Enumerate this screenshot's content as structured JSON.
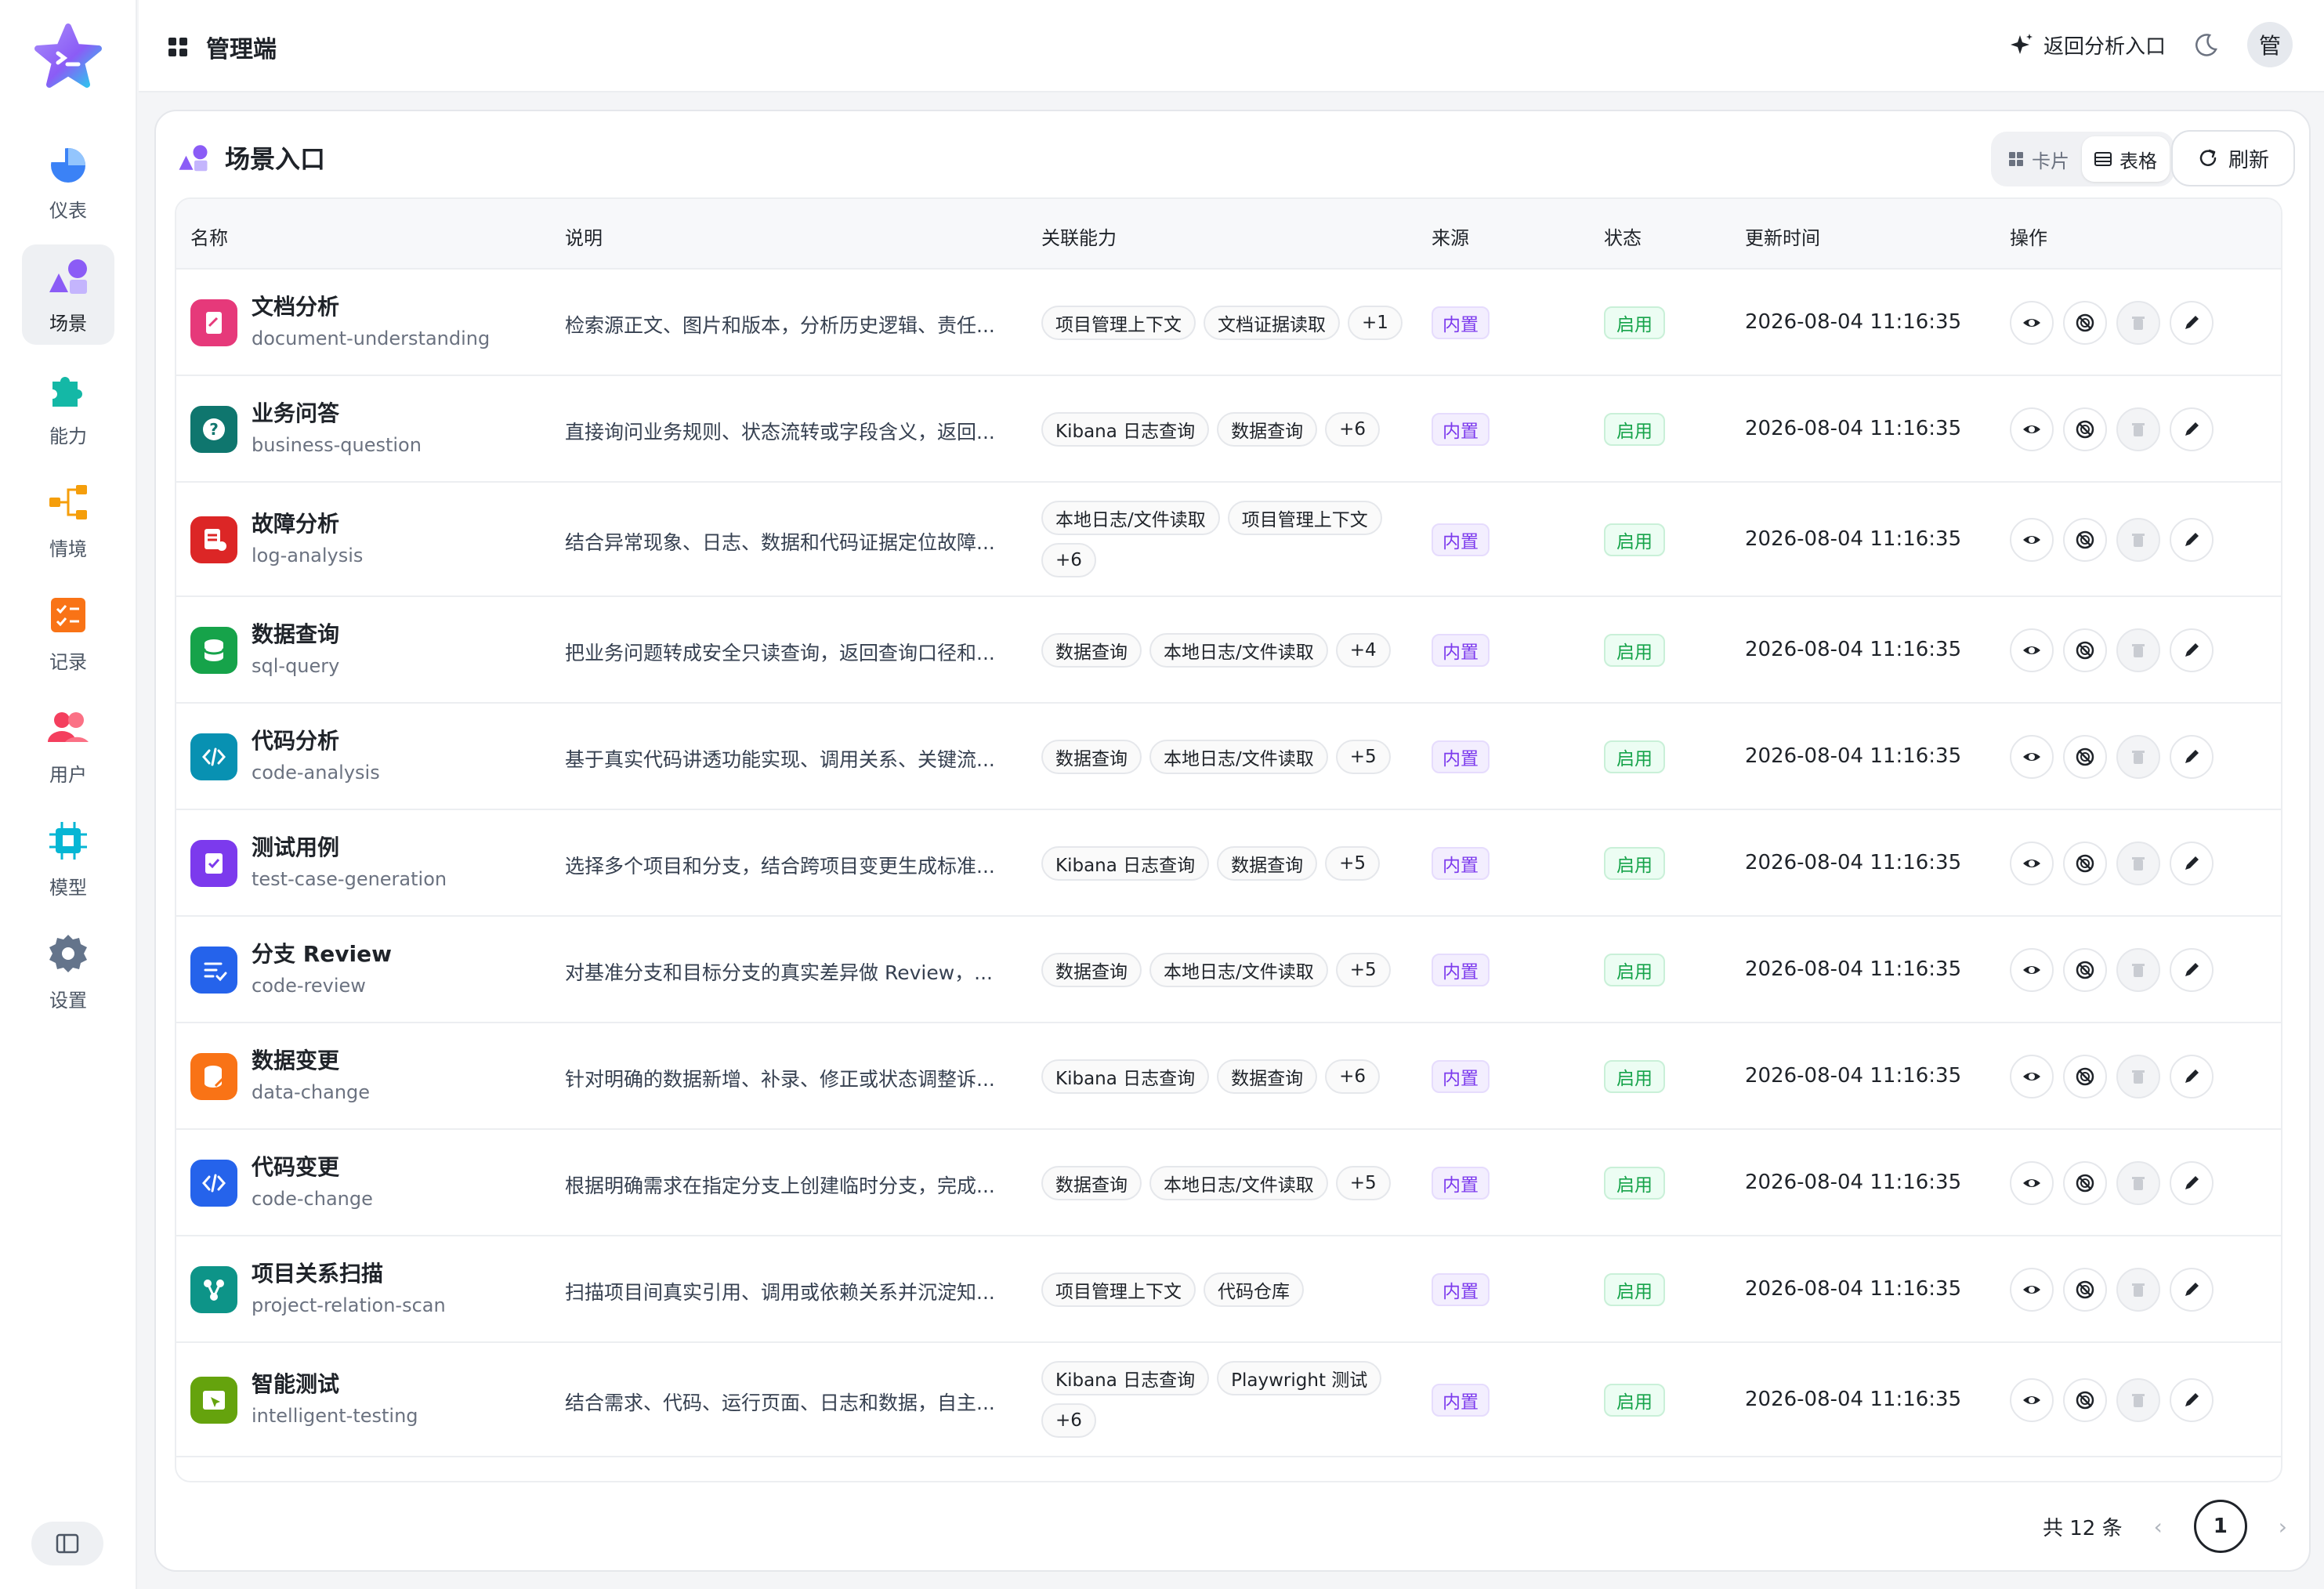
{
  "header": {
    "title": "管理端",
    "back_label": "返回分析入口",
    "avatar_text": "管"
  },
  "sidebar": {
    "items": [
      {
        "label": "仪表",
        "icon": "pie-chart-icon"
      },
      {
        "label": "场景",
        "icon": "shapes-icon"
      },
      {
        "label": "能力",
        "icon": "puzzle-icon"
      },
      {
        "label": "情境",
        "icon": "flow-icon"
      },
      {
        "label": "记录",
        "icon": "checklist-icon"
      },
      {
        "label": "用户",
        "icon": "users-icon"
      },
      {
        "label": "模型",
        "icon": "chip-icon"
      },
      {
        "label": "设置",
        "icon": "gear-icon"
      }
    ],
    "active": "场景"
  },
  "panel": {
    "title": "场景入口",
    "view_card": "卡片",
    "view_table": "表格",
    "refresh": "刷新"
  },
  "table": {
    "columns": [
      "名称",
      "说明",
      "关联能力",
      "来源",
      "状态",
      "更新时间",
      "操作"
    ],
    "rows": [
      {
        "name": "文档分析",
        "code": "document-understanding",
        "desc": "检索源正文、图片和版本，分析历史逻辑、责任...",
        "caps": [
          "项目管理上下文",
          "文档证据读取",
          "+1"
        ],
        "source": "内置",
        "status": "启用",
        "time": "2026-08-04 11:16:35",
        "color": "#e6397a"
      },
      {
        "name": "业务问答",
        "code": "business-question",
        "desc": "直接询问业务规则、状态流转或字段含义，返回...",
        "caps": [
          "Kibana 日志查询",
          "数据查询",
          "+6"
        ],
        "source": "内置",
        "status": "启用",
        "time": "2026-08-04 11:16:35",
        "color": "#0f766e"
      },
      {
        "name": "故障分析",
        "code": "log-analysis",
        "desc": "结合异常现象、日志、数据和代码证据定位故障...",
        "caps": [
          "本地日志/文件读取",
          "项目管理上下文",
          "+6"
        ],
        "source": "内置",
        "status": "启用",
        "time": "2026-08-04 11:16:35",
        "color": "#dc2626"
      },
      {
        "name": "数据查询",
        "code": "sql-query",
        "desc": "把业务问题转成安全只读查询，返回查询口径和...",
        "caps": [
          "数据查询",
          "本地日志/文件读取",
          "+4"
        ],
        "source": "内置",
        "status": "启用",
        "time": "2026-08-04 11:16:35",
        "color": "#16a34a"
      },
      {
        "name": "代码分析",
        "code": "code-analysis",
        "desc": "基于真实代码讲透功能实现、调用关系、关键流...",
        "caps": [
          "数据查询",
          "本地日志/文件读取",
          "+5"
        ],
        "source": "内置",
        "status": "启用",
        "time": "2026-08-04 11:16:35",
        "color": "#0891b2"
      },
      {
        "name": "测试用例",
        "code": "test-case-generation",
        "desc": "选择多个项目和分支，结合跨项目变更生成标准...",
        "caps": [
          "Kibana 日志查询",
          "数据查询",
          "+5"
        ],
        "source": "内置",
        "status": "启用",
        "time": "2026-08-04 11:16:35",
        "color": "#7c3aed"
      },
      {
        "name": "分支 Review",
        "code": "code-review",
        "desc": "对基准分支和目标分支的真实差异做 Review，...",
        "caps": [
          "数据查询",
          "本地日志/文件读取",
          "+5"
        ],
        "source": "内置",
        "status": "启用",
        "time": "2026-08-04 11:16:35",
        "color": "#2563eb"
      },
      {
        "name": "数据变更",
        "code": "data-change",
        "desc": "针对明确的数据新增、补录、修正或状态调整诉...",
        "caps": [
          "Kibana 日志查询",
          "数据查询",
          "+6"
        ],
        "source": "内置",
        "status": "启用",
        "time": "2026-08-04 11:16:35",
        "color": "#f97316"
      },
      {
        "name": "代码变更",
        "code": "code-change",
        "desc": "根据明确需求在指定分支上创建临时分支，完成...",
        "caps": [
          "数据查询",
          "本地日志/文件读取",
          "+5"
        ],
        "source": "内置",
        "status": "启用",
        "time": "2026-08-04 11:16:35",
        "color": "#2563eb"
      },
      {
        "name": "项目关系扫描",
        "code": "project-relation-scan",
        "desc": "扫描项目间真实引用、调用或依赖关系并沉淀知...",
        "caps": [
          "项目管理上下文",
          "代码仓库"
        ],
        "source": "内置",
        "status": "启用",
        "time": "2026-08-04 11:16:35",
        "color": "#0d9488"
      },
      {
        "name": "智能测试",
        "code": "intelligent-testing",
        "desc": "结合需求、代码、运行页面、日志和数据，自主...",
        "caps": [
          "Kibana 日志查询",
          "Playwright 测试",
          "+6"
        ],
        "source": "内置",
        "status": "启用",
        "time": "2026-08-04 11:16:35",
        "color": "#65a30d"
      }
    ]
  },
  "pagination": {
    "total": "共 12 条",
    "page": "1"
  }
}
